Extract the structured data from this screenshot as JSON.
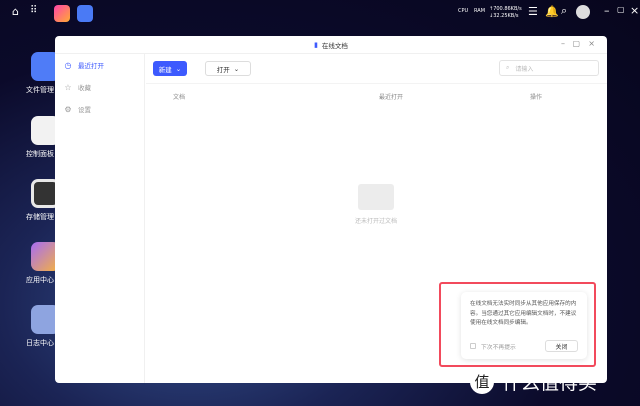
{
  "topbar": {
    "net_up": "↑700.86KB/s",
    "net_down": "↓32.25KB/s",
    "cpu": "CPU",
    "ram": "RAM"
  },
  "desktop": [
    {
      "label": "文件管理",
      "color": "#4f7cf7"
    },
    {
      "label": "控制面板",
      "color": "#f2f2f2"
    },
    {
      "label": "存储管理",
      "color": "#e8e8e8"
    },
    {
      "label": "应用中心",
      "color": "#f3f3f3"
    },
    {
      "label": "日志中心",
      "color": "#8ea4e0"
    }
  ],
  "window": {
    "title": "在线文档"
  },
  "sidebar": {
    "items": [
      {
        "label": "最近打开",
        "icon": "clock-icon"
      },
      {
        "label": "收藏",
        "icon": "star-icon"
      },
      {
        "label": "设置",
        "icon": "gear-icon"
      }
    ]
  },
  "toolbar": {
    "new_label": "新建",
    "open_label": "打开",
    "search_placeholder": "请输入"
  },
  "table": {
    "headers": [
      "文档",
      "最近打开",
      "操作"
    ]
  },
  "empty": {
    "text": "还未打开过文档"
  },
  "dialog": {
    "message": "在线文档无法实时同步从其他应用保存的内容。当您通过其它应用编辑文档时，不建议使用在线文档同步编辑。",
    "checkbox_label": "下次不再提示",
    "close_label": "关闭"
  },
  "watermark": {
    "seal": "值",
    "text": "什么值得买"
  }
}
